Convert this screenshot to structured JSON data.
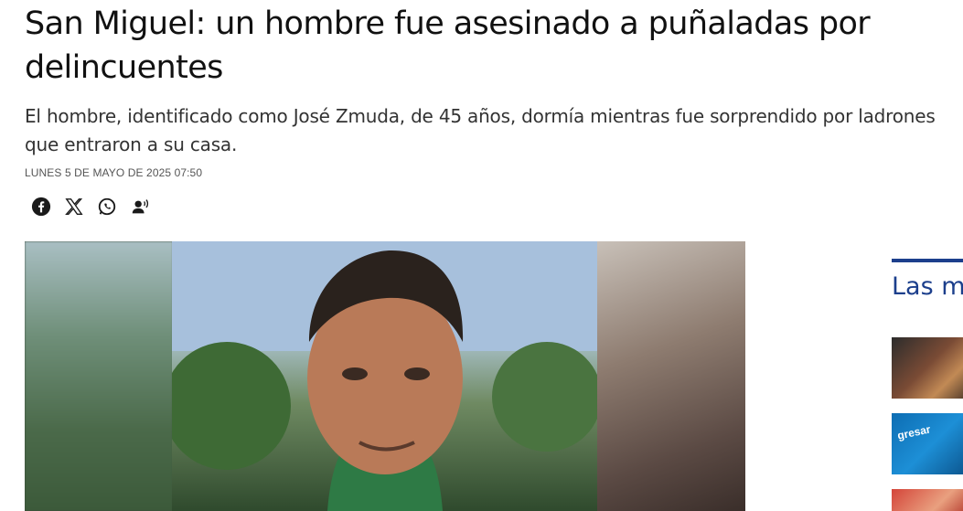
{
  "article": {
    "headline": "San Miguel: un hombre fue asesinado a puñaladas por delincuentes",
    "subtitle": "El hombre, identificado como José Zmuda, de 45 años, dormía mientras fue sorprendido por ladrones que entraron a su casa.",
    "date": "LUNES 5 DE MAYO DE 2025 07:50"
  },
  "share": {
    "icons": [
      "facebook-icon",
      "x-icon",
      "whatsapp-icon",
      "listen-audio-icon"
    ]
  },
  "hero": {
    "image": "photo-of-man-outdoors"
  },
  "sidebar": {
    "title": "Las m",
    "thumbnails": [
      {
        "label": ""
      },
      {
        "label": "gresar"
      },
      {
        "label": ""
      }
    ]
  },
  "colors": {
    "accent": "#1c3f8c",
    "text": "#111111",
    "muted": "#555555"
  }
}
